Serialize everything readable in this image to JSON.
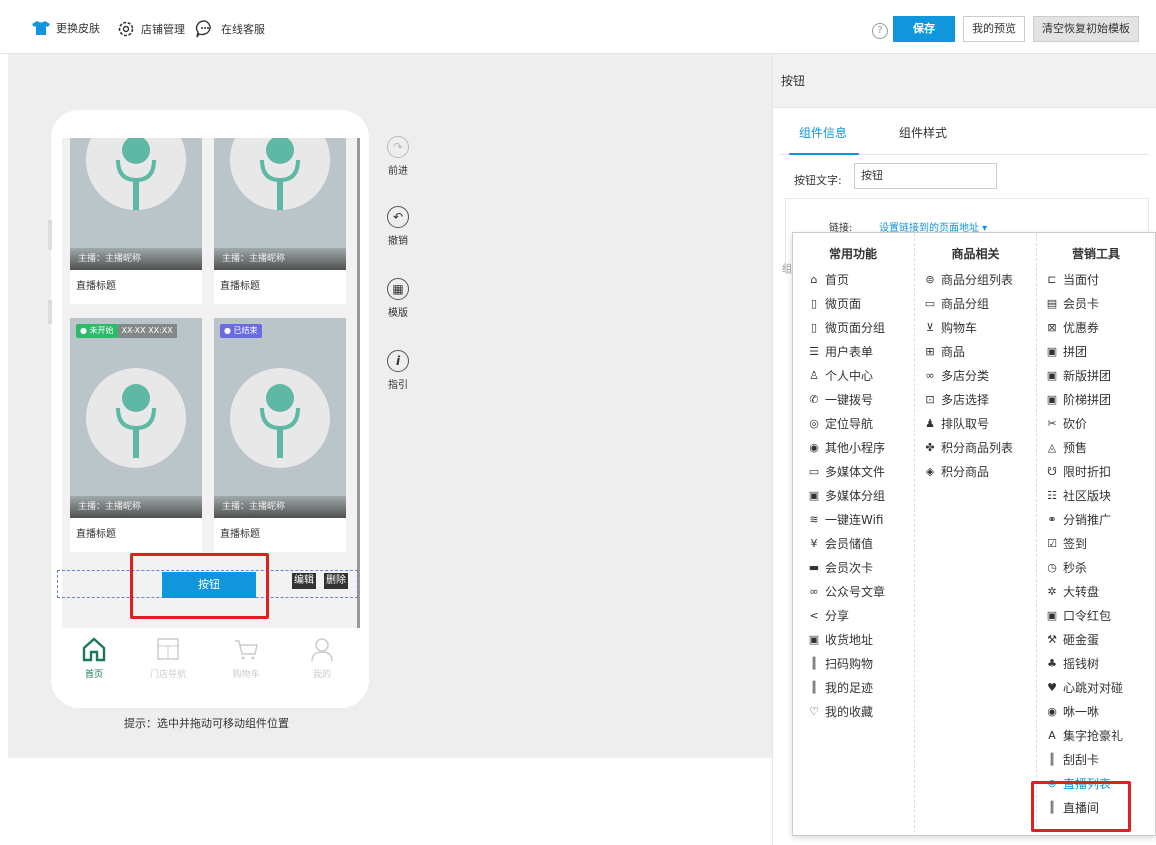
{
  "topbar": {
    "skin": "更换皮肤",
    "shop": "店铺管理",
    "service": "在线客服",
    "help": "?",
    "save": "保存",
    "preview": "我的预览",
    "reset": "清空恢复初始模板"
  },
  "phone": {
    "cards": [
      {
        "anchor": "主播：主播昵称",
        "title": "直播标题"
      },
      {
        "anchor": "主播：主播昵称",
        "title": "直播标题"
      },
      {
        "anchor": "主播：主播昵称",
        "title": "直播标题",
        "status": "● 未开始",
        "time": "XX-XX XX:XX"
      },
      {
        "anchor": "主播：主播昵称",
        "title": "直播标题",
        "status": "● 已结束"
      }
    ],
    "button_label": "按钮",
    "edit": "编辑",
    "delete": "删除",
    "tabs": [
      "首页",
      "门店导航",
      "购物车",
      "我的"
    ],
    "tip": "提示：选中并拖动可移动组件位置"
  },
  "side_tools": [
    "前进",
    "撤销",
    "模版",
    "指引"
  ],
  "panel": {
    "title": "按钮",
    "tabs": [
      "组件信息",
      "组件样式"
    ],
    "field_label": "按钮文字:",
    "field_value": "按钮",
    "link_label": "链接:",
    "link_value": "设置链接到的页面地址 ▾",
    "hidden_char": "组"
  },
  "dropdown": {
    "col1": {
      "header": "常用功能",
      "items": [
        {
          "icon": "home-icon",
          "glyph": "⌂",
          "label": "首页"
        },
        {
          "icon": "page-icon",
          "glyph": "▯",
          "label": "微页面"
        },
        {
          "icon": "page-group-icon",
          "glyph": "▯",
          "label": "微页面分组"
        },
        {
          "icon": "form-icon",
          "glyph": "☰",
          "label": "用户表单"
        },
        {
          "icon": "user-icon",
          "glyph": "♙",
          "label": "个人中心"
        },
        {
          "icon": "phone-icon",
          "glyph": "✆",
          "label": "一键拨号"
        },
        {
          "icon": "location-icon",
          "glyph": "◎",
          "label": "定位导航"
        },
        {
          "icon": "miniapp-icon",
          "glyph": "◉",
          "label": "其他小程序"
        },
        {
          "icon": "media-icon",
          "glyph": "▭",
          "label": "多媒体文件"
        },
        {
          "icon": "media-group-icon",
          "glyph": "▣",
          "label": "多媒体分组"
        },
        {
          "icon": "wifi-icon",
          "glyph": "≋",
          "label": "一键连Wifi"
        },
        {
          "icon": "yen-icon",
          "glyph": "¥",
          "label": "会员储值"
        },
        {
          "icon": "card-icon",
          "glyph": "▬",
          "label": "会员次卡"
        },
        {
          "icon": "link-icon",
          "glyph": "∞",
          "label": "公众号文章"
        },
        {
          "icon": "share-icon",
          "glyph": "<",
          "label": "分享"
        },
        {
          "icon": "address-icon",
          "glyph": "▣",
          "label": "收货地址"
        },
        {
          "icon": "barcode-icon",
          "glyph": "║",
          "label": "扫码购物"
        },
        {
          "icon": "footprint-icon",
          "glyph": "║",
          "label": "我的足迹"
        },
        {
          "icon": "heart-icon",
          "glyph": "♡",
          "label": "我的收藏"
        }
      ]
    },
    "col2": {
      "header": "商品相关",
      "items": [
        {
          "icon": "list-icon",
          "glyph": "⊜",
          "label": "商品分组列表"
        },
        {
          "icon": "group-icon",
          "glyph": "▭",
          "label": "商品分组"
        },
        {
          "icon": "cart-icon",
          "glyph": "⊻",
          "label": "购物车"
        },
        {
          "icon": "gift-icon",
          "glyph": "⊞",
          "label": "商品"
        },
        {
          "icon": "category-icon",
          "glyph": "∞",
          "label": "多店分类"
        },
        {
          "icon": "store-icon",
          "glyph": "⊡",
          "label": "多店选择"
        },
        {
          "icon": "queue-icon",
          "glyph": "♟",
          "label": "排队取号"
        },
        {
          "icon": "points-list-icon",
          "glyph": "✤",
          "label": "积分商品列表"
        },
        {
          "icon": "diamond-icon",
          "glyph": "◈",
          "label": "积分商品"
        }
      ]
    },
    "col3": {
      "header": "营销工具",
      "items": [
        {
          "icon": "pay-icon",
          "glyph": "⊏",
          "label": "当面付"
        },
        {
          "icon": "member-card-icon",
          "glyph": "▤",
          "label": "会员卡"
        },
        {
          "icon": "coupon-icon",
          "glyph": "⊠",
          "label": "优惠券"
        },
        {
          "icon": "group-buy-icon",
          "glyph": "▣",
          "label": "拼团"
        },
        {
          "icon": "new-group-icon",
          "glyph": "▣",
          "label": "新版拼团"
        },
        {
          "icon": "ladder-group-icon",
          "glyph": "▣",
          "label": "阶梯拼团"
        },
        {
          "icon": "bargain-icon",
          "glyph": "✂",
          "label": "砍价"
        },
        {
          "icon": "presale-icon",
          "glyph": "◬",
          "label": "预售"
        },
        {
          "icon": "discount-icon",
          "glyph": "☋",
          "label": "限时折扣"
        },
        {
          "icon": "community-icon",
          "glyph": "☷",
          "label": "社区版块"
        },
        {
          "icon": "distribution-icon",
          "glyph": "⚭",
          "label": "分销推广"
        },
        {
          "icon": "checkin-icon",
          "glyph": "☑",
          "label": "签到"
        },
        {
          "icon": "seckill-icon",
          "glyph": "◷",
          "label": "秒杀"
        },
        {
          "icon": "wheel-icon",
          "glyph": "✲",
          "label": "大转盘"
        },
        {
          "icon": "redpacket-icon",
          "glyph": "▣",
          "label": "口令红包"
        },
        {
          "icon": "egg-icon",
          "glyph": "⚒",
          "label": "砸金蛋"
        },
        {
          "icon": "tree-icon",
          "glyph": "♣",
          "label": "摇钱树"
        },
        {
          "icon": "heartbeat-icon",
          "glyph": "♥",
          "label": "心跳对对碰"
        },
        {
          "icon": "shake-icon",
          "glyph": "◉",
          "label": "咻一咻"
        },
        {
          "icon": "letter-icon",
          "glyph": "A",
          "label": "集字抢豪礼"
        },
        {
          "icon": "scratch-icon",
          "glyph": "║",
          "label": "刮刮卡"
        },
        {
          "icon": "live-list-icon",
          "glyph": "⊜",
          "label": "直播列表",
          "highlight": true
        },
        {
          "icon": "live-room-icon",
          "glyph": "║",
          "label": "直播间"
        }
      ]
    }
  },
  "colors": {
    "accent": "#1296db",
    "highlight_border": "#e02020",
    "mic": "#5fb8a4"
  }
}
